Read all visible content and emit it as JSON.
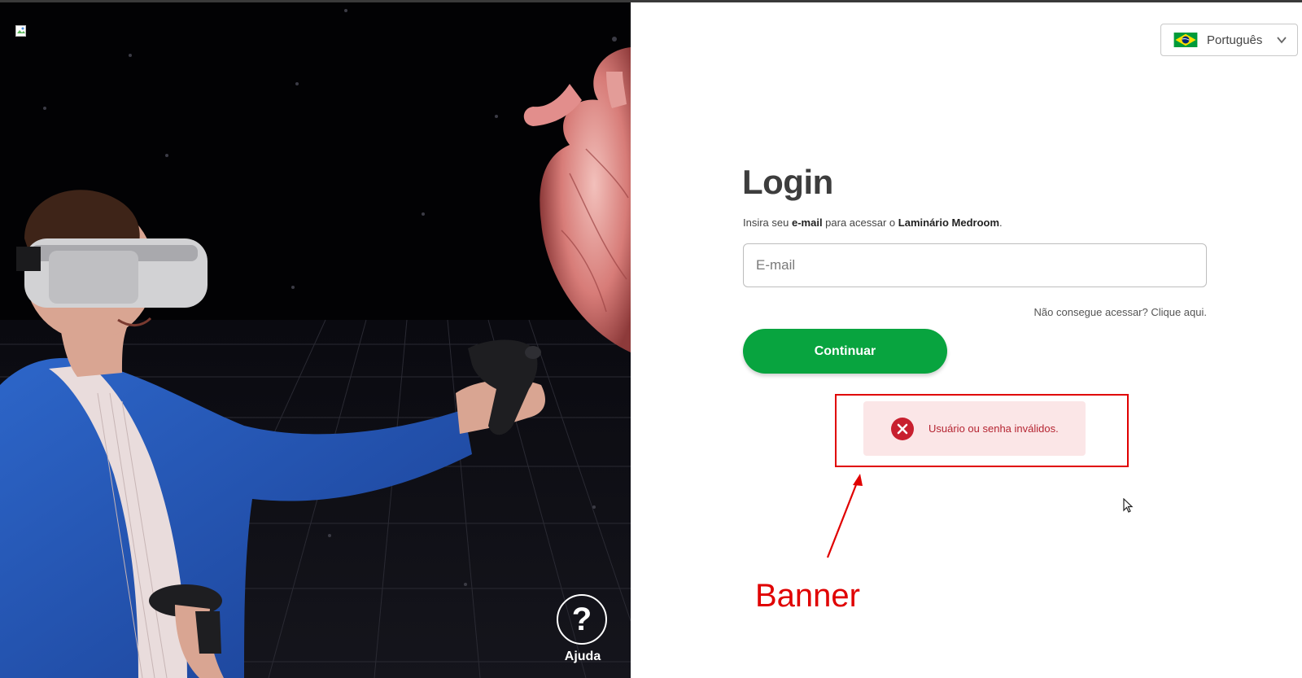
{
  "hero": {
    "help_label": "Ajuda",
    "help_icon": "?"
  },
  "language": {
    "selected": "Português",
    "flag": "brazil-flag-icon"
  },
  "login": {
    "title": "Login",
    "subtitle_prefix": "Insira seu ",
    "subtitle_bold1": "e-mail",
    "subtitle_middle": " para acessar o ",
    "subtitle_bold2": "Laminário Medroom",
    "subtitle_suffix": ".",
    "email_placeholder": "E-mail",
    "forgot_link": "Não consegue acessar? Clique aqui.",
    "continue_label": "Continuar"
  },
  "error_toast": {
    "message": "Usuário ou senha inválidos.",
    "icon": "error-x-icon"
  },
  "annotation": {
    "label": "Banner"
  },
  "colors": {
    "primary_button": "#08a43f",
    "error_text": "#b52532",
    "error_bg": "#fbe6e7",
    "annotation_red": "#e00000"
  }
}
